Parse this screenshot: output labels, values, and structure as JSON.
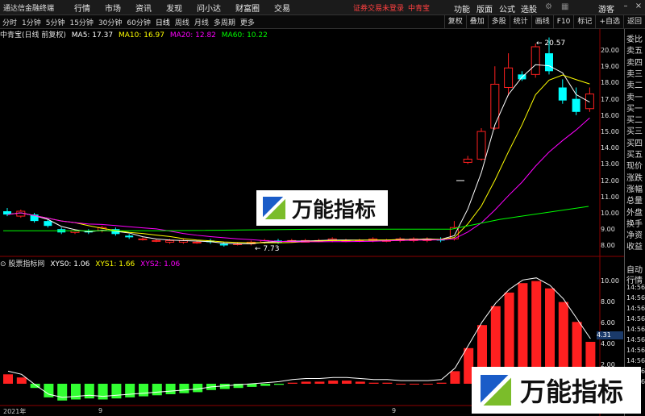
{
  "menubar": {
    "app_title": "通达信金融终端",
    "items": [
      "行情",
      "市场",
      "资讯",
      "发现",
      "问小达",
      "财富圈",
      "交易"
    ],
    "warning": "证券交易未登录",
    "stock": "中青宝",
    "right_items": [
      "功能",
      "版面",
      "公式",
      "选股",
      "游客"
    ]
  },
  "periods": [
    "分时",
    "1分钟",
    "5分钟",
    "15分钟",
    "30分钟",
    "60分钟",
    "日线",
    "周线",
    "月线",
    "多周期",
    "更多"
  ],
  "selected_period": "日线",
  "tools": [
    "复权",
    "叠加",
    "多股",
    "统计",
    "画线",
    "F10",
    "标记",
    "+自选",
    "返回"
  ],
  "main": {
    "title": "中青宝(日线 前复权)",
    "ma5": "MA5: 17.37",
    "ma10": "MA10: 16.97",
    "ma20": "MA20: 12.82",
    "ma60": "MA60: 10.22",
    "high_label": "20.57",
    "low_label": "7.73",
    "y_ticks": [
      "20.00",
      "19.00",
      "18.00",
      "17.00",
      "16.00",
      "15.00",
      "14.00",
      "13.00",
      "12.00",
      "11.00",
      "10.00",
      "9.00",
      "8.00"
    ]
  },
  "sub": {
    "title": "股票指标网",
    "xys0": "XYS0: 1.06",
    "xys1": "XYS1: 1.66",
    "xys2": "XYS2: 1.06",
    "y_ticks": [
      "10.00",
      "8.00",
      "6.00",
      "4.00",
      "2.00"
    ],
    "marker": "4.31"
  },
  "right_panel": {
    "labels": [
      "委比",
      "卖五",
      "卖四",
      "卖三",
      "卖二",
      "卖一",
      "买一",
      "买二",
      "买三",
      "买四",
      "买五",
      "现价",
      "涨跌",
      "涨幅",
      "总量",
      "外盘",
      "换手",
      "净资",
      "收益"
    ],
    "labels2": [
      "自动",
      "行情",
      "14:56",
      "14:56",
      "14:56",
      "14:56",
      "14:56",
      "14:56",
      "14:56",
      "14:56",
      "14:56",
      "14:56"
    ]
  },
  "x_axis": {
    "year": "2021年",
    "m1": "9",
    "m2": "9"
  },
  "watermark": {
    "text": "万能指标"
  },
  "colors": {
    "up": "#ff2020",
    "down": "#00ffff",
    "ma5": "#ffffff",
    "ma10": "#ffff00",
    "ma20": "#ff00ff",
    "ma60": "#00ff00"
  }
}
